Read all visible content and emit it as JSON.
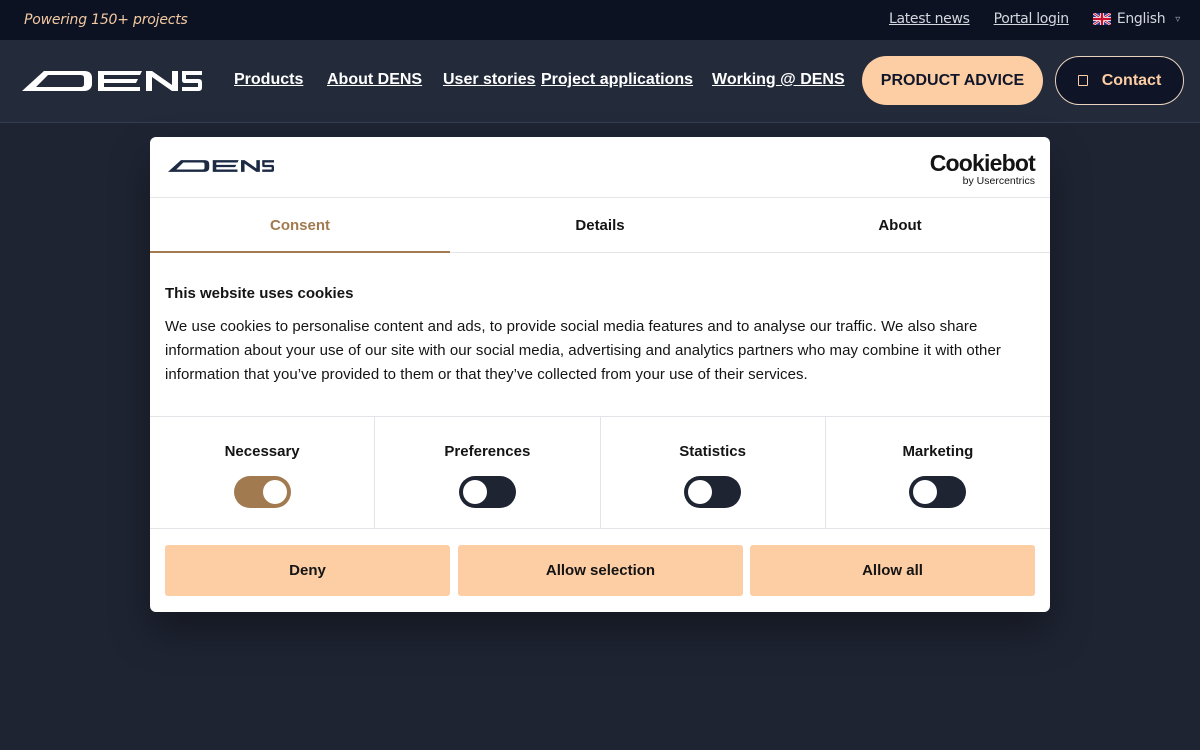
{
  "topbar": {
    "tagline": "Powering 150+ projects",
    "links": [
      "Latest news",
      "Portal login"
    ],
    "language": "English",
    "language_icon": "uk-flag-icon",
    "language_caret_icon": "chevron-down-icon"
  },
  "header": {
    "logo_text": "DENS",
    "nav": [
      "Products",
      "About DENS",
      "User stories",
      "Project applications",
      "Working @ DENS"
    ],
    "advice_label": "PRODUCT ADVICE",
    "contact_label": "Contact",
    "contact_icon": "phone-icon"
  },
  "dialog": {
    "logo_text": "DENS",
    "brand_main": "Cookiebot",
    "brand_sub": "by Usercentrics",
    "tabs": [
      {
        "label": "Consent",
        "active": true
      },
      {
        "label": "Details",
        "active": false
      },
      {
        "label": "About",
        "active": false
      }
    ],
    "heading": "This website uses cookies",
    "body": "We use cookies to personalise content and ads, to provide social media features and to analyse our traffic. We also share information about your use of our site with our social media, advertising and analytics partners who may combine it with other information that you’ve provided to them or that they’ve collected from your use of their services.",
    "categories": [
      {
        "label": "Necessary",
        "checked": true
      },
      {
        "label": "Preferences",
        "checked": false
      },
      {
        "label": "Statistics",
        "checked": false
      },
      {
        "label": "Marketing",
        "checked": false
      }
    ],
    "buttons": {
      "deny": "Deny",
      "allow_selection": "Allow selection",
      "allow_all": "Allow all"
    }
  },
  "colors": {
    "accent": "#a27a4f",
    "button_peach": "#fdcda4",
    "page_bg": "#1f2433",
    "topbar_bg": "#0c1222"
  }
}
